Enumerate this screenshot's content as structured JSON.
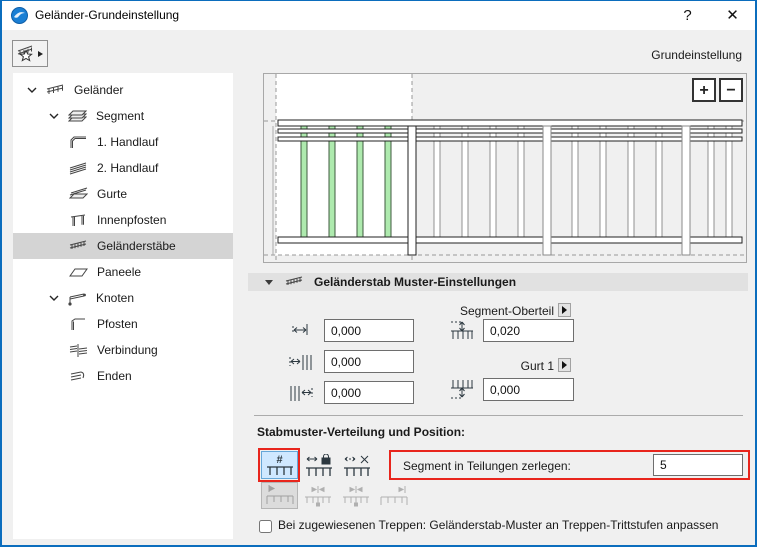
{
  "window": {
    "title": "Geländer-Grundeinstellung",
    "help_glyph": "?",
    "close_glyph": "✕"
  },
  "toolbar": {
    "mode_label": "Grundeinstellung"
  },
  "tree": {
    "items": [
      {
        "label": "Geländer"
      },
      {
        "label": "Segment"
      },
      {
        "label": "1. Handlauf"
      },
      {
        "label": "2. Handlauf"
      },
      {
        "label": "Gurte"
      },
      {
        "label": "Innenpfosten"
      },
      {
        "label": "Geländerstäbe"
      },
      {
        "label": "Paneele"
      },
      {
        "label": "Knoten"
      },
      {
        "label": "Pfosten"
      },
      {
        "label": "Verbindung"
      },
      {
        "label": "Enden"
      }
    ]
  },
  "preview": {
    "zoom_in_label": "+",
    "zoom_out_label": "−"
  },
  "pattern_section": {
    "title": "Geländerstab Muster-Einstellungen",
    "top_flyout_label": "Segment-Oberteil",
    "bottom_flyout_label": "Gurt 1",
    "fields": {
      "first_offset": "0,000",
      "left_spacing": "0,000",
      "right_spacing": "0,000",
      "top_offset": "0,020",
      "bottom_offset": "0,000"
    }
  },
  "distribution": {
    "title": "Stabmuster-Verteilung und Position:",
    "hash_glyph": "#",
    "division_label": "Segment in Teilungen zerlegen:",
    "division_value": "5"
  },
  "stair_option": {
    "label": "Bei zugewiesenen Treppen: Geländerstab-Muster an Treppen-Trittstufen anpassen",
    "checked": false
  },
  "colors": {
    "accent_blue": "#0b6dbd",
    "highlight_red": "#e8251c",
    "selected_button_bg": "#cfe8ff",
    "baluster_green": "#aeeaae"
  }
}
